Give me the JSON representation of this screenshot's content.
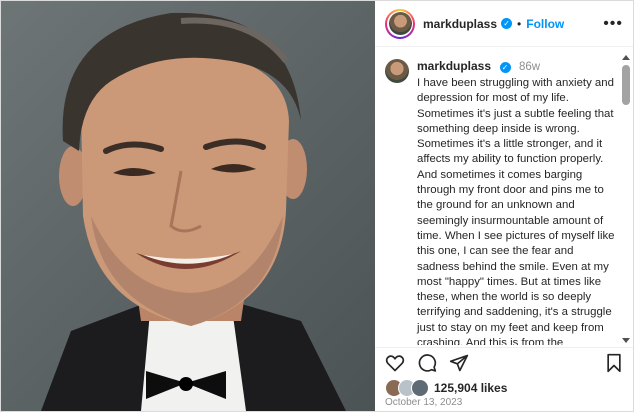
{
  "post": {
    "username": "markduplass",
    "follow_label": "Follow",
    "more_label": "•••",
    "separator": "•",
    "verified_mark": "✓"
  },
  "comment": {
    "username": "markduplass",
    "time": "86w",
    "text": "I have been struggling with anxiety and depression for most of my life. Sometimes it's just a subtle feeling that something deep inside is wrong. Sometimes it's a little stronger, and it affects my ability to function properly. And sometimes it comes barging through my front door and pins me to the ground for an unknown and seemingly insurmountable amount of time. When I see pictures of myself like this one, I can see the fear and sadness behind the smile. Even at my most \"happy\" times. But at times like these, when the world is so deeply terrifying and saddening, it's a struggle just to stay on my feet and keep from crashing. And this is from the perspective of someone with years of"
  },
  "engagement": {
    "likes": "125,904 likes",
    "date": "October 13, 2023"
  },
  "icons": [
    "verified-badge-icon",
    "more-options-icon",
    "heart-icon",
    "comment-icon",
    "share-icon",
    "bookmark-icon"
  ],
  "colors": {
    "accent": "#0095f6",
    "text": "#262626",
    "muted": "#8e8e8e"
  }
}
